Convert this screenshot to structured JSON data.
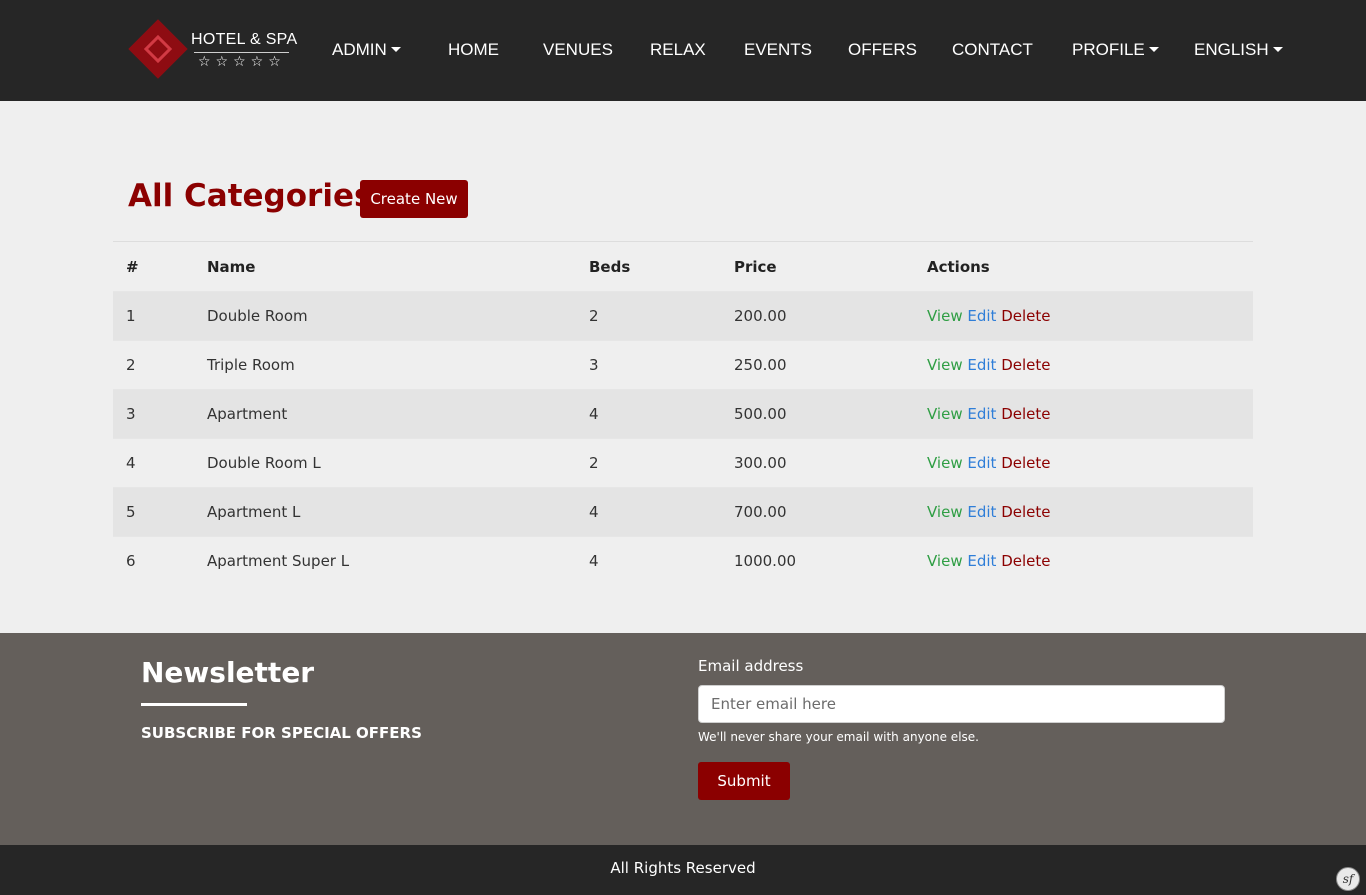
{
  "brand": {
    "name": "HOTEL & SPA",
    "stars": "☆☆☆☆☆"
  },
  "nav": {
    "admin": "ADMIN",
    "home": "HOME",
    "venues": "VENUES",
    "relax": "RELAX",
    "events": "EVENTS",
    "offers": "OFFERS",
    "contact": "CONTACT",
    "profile": "PROFILE",
    "language": "ENGLISH"
  },
  "page": {
    "title": "All Categories",
    "separator": "-",
    "create_label": "Create New"
  },
  "table": {
    "headers": [
      "#",
      "Name",
      "Beds",
      "Price",
      "Actions"
    ],
    "rows": [
      {
        "id": "1",
        "name": "Double Room",
        "beds": "2",
        "price": "200.00"
      },
      {
        "id": "2",
        "name": "Triple Room",
        "beds": "3",
        "price": "250.00"
      },
      {
        "id": "3",
        "name": "Apartment",
        "beds": "4",
        "price": "500.00"
      },
      {
        "id": "4",
        "name": "Double Room L",
        "beds": "2",
        "price": "300.00"
      },
      {
        "id": "5",
        "name": "Apartment L",
        "beds": "4",
        "price": "700.00"
      },
      {
        "id": "6",
        "name": "Apartment Super L",
        "beds": "4",
        "price": "1000.00"
      }
    ],
    "actions": {
      "view": "View",
      "edit": "Edit",
      "delete": "Delete"
    }
  },
  "newsletter": {
    "title": "Newsletter",
    "subtitle": "SUBSCRIBE FOR SPECIAL OFFERS",
    "email_label": "Email address",
    "email_placeholder": "Enter email here",
    "email_value": "",
    "help_text": "We'll never share your email with anyone else.",
    "submit_label": "Submit"
  },
  "footer": {
    "text": "All Rights Reserved",
    "badge": "sf"
  },
  "colors": {
    "accent": "#8b0000",
    "navbar": "#262626",
    "newsletter_bg": "#645f5b",
    "view": "#2f9e44",
    "edit": "#2f7ed8"
  },
  "icons": {
    "logo": "hotel-logo-icon",
    "dropdown": "caret-down-icon",
    "debug": "symfony-icon"
  }
}
